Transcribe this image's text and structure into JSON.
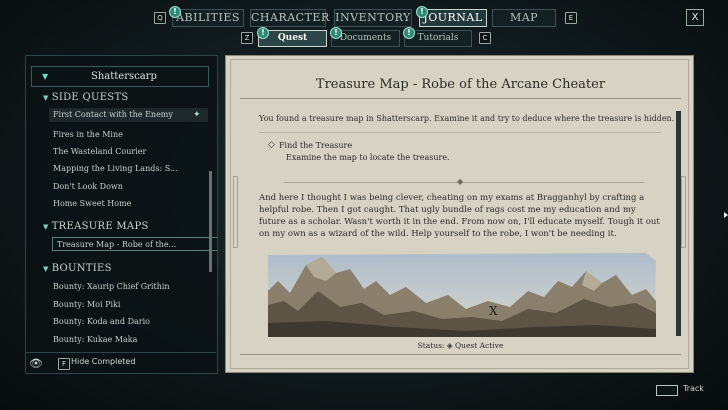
{
  "keys": {
    "nav_left": "Q",
    "nav_right": "E",
    "sub_left": "Z",
    "sub_right": "C",
    "hide": "F"
  },
  "tabs": [
    {
      "label": "ABILITIES",
      "alert": "!"
    },
    {
      "label": "CHARACTER"
    },
    {
      "label": "INVENTORY"
    },
    {
      "label": "JOURNAL",
      "alert": "!"
    },
    {
      "label": "MAP"
    }
  ],
  "subtabs": [
    {
      "label": "Quest",
      "alert": "!"
    },
    {
      "label": "Documents",
      "alert": "!"
    },
    {
      "label": "Tutorials",
      "alert": "!"
    }
  ],
  "close_label": "X",
  "sidebar": {
    "region": "Shatterscarp",
    "categories": [
      {
        "label": "SIDE QUESTS",
        "items": [
          "First Contact with the Enemy",
          "Fires in the Mine",
          "The Wasteland Courier",
          "Mapping the Living Lands: S...",
          "Don't Look Down",
          "Home Sweet Home"
        ]
      },
      {
        "label": "TREASURE MAPS",
        "items": [
          "Treasure Map - Robe of the..."
        ]
      },
      {
        "label": "BOUNTIES",
        "items": [
          "Bounty: Xaurip Chief Grithin",
          "Bounty: Moi Piki",
          "Bounty: Koda and Dario",
          "Bounty: Kukae Maka"
        ]
      }
    ],
    "hide_label": "Hide Completed"
  },
  "quest": {
    "title": "Treasure Map - Robe of the Arcane Cheater",
    "intro": "You found a treasure map in Shatterscarp. Examine it and try to deduce where the treasure is hidden.",
    "objective_title": "Find the Treasure",
    "objective_desc": "Examine the map to locate the treasure.",
    "letter": "And here I thought I was being clever, cheating on my exams at Bragganhyl by crafting a helpful robe. Then I got caught. That ugly bundle of rags cost me my education and my future as a scholar. Wasn't worth it in the end. From now on, I'll educate myself. Tough it out on my own as a wizard of the wild. Help yourself to the robe, I won't be needing it.",
    "status_label": "Status:",
    "status_value": "Quest Active",
    "map_mark": "X"
  },
  "footer": {
    "track_label": "Track"
  }
}
